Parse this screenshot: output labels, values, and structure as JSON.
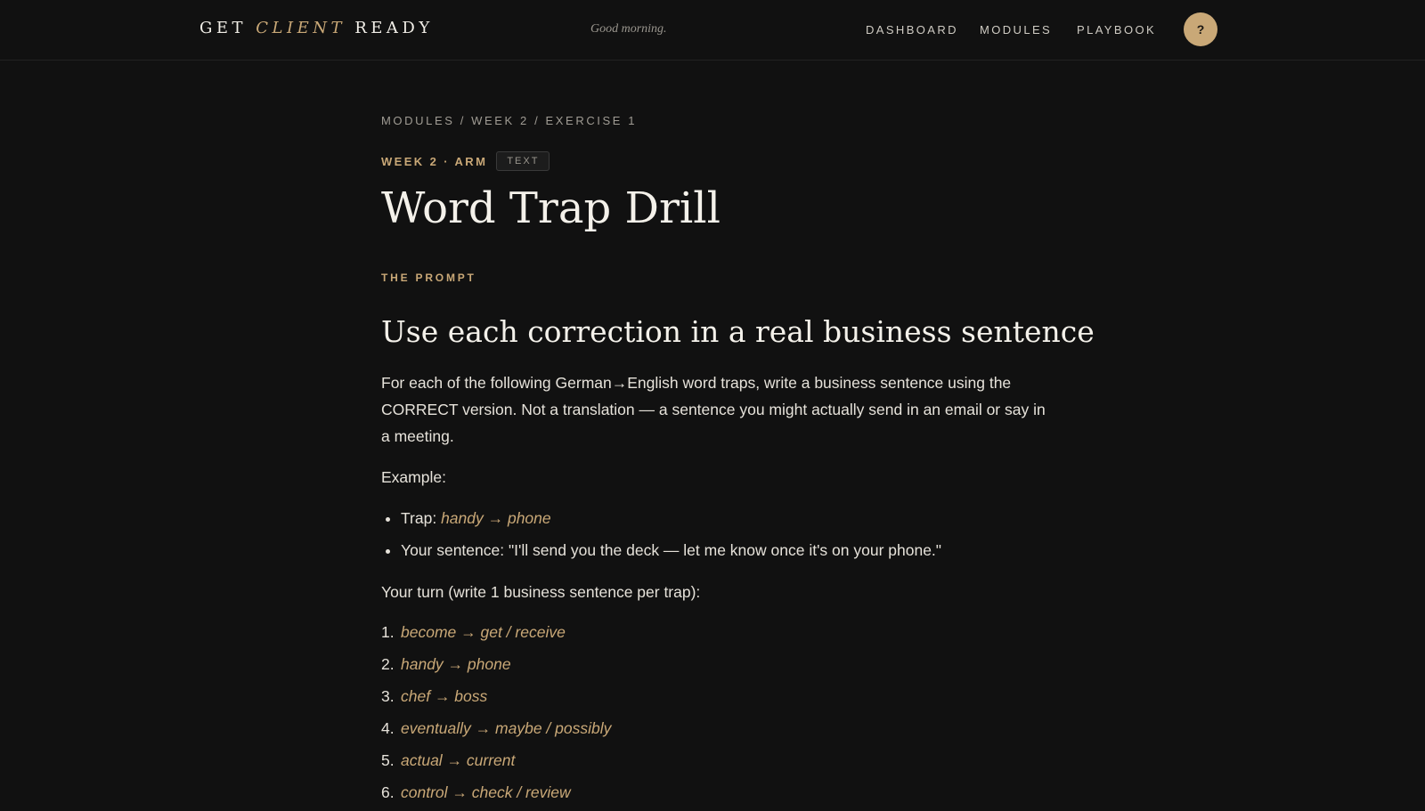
{
  "header": {
    "logo": {
      "part1": "GET ",
      "accent": "CLIENT",
      "part2": " READY"
    },
    "greeting": "Good morning.",
    "nav": {
      "dashboard": "DASHBOARD",
      "modules": "MODULES",
      "playbook": "PLAYBOOK"
    },
    "help_label": "?"
  },
  "breadcrumb": {
    "item1": "MODULES",
    "sep": " / ",
    "item2": "WEEK 2",
    "item3": "EXERCISE 1"
  },
  "meta": {
    "week_tag": "WEEK 2 · ARM",
    "type_badge": "TEXT"
  },
  "page_title": "Word Trap Drill",
  "section_label": "THE PROMPT",
  "prompt": {
    "heading": "Use each correction in a real business sentence",
    "intro": "For each of the following German→English word traps, write a business sentence using the CORRECT version. Not a translation — a sentence you might actually send in an email or say in a meeting.",
    "example_label": "Example:",
    "example": {
      "trap_label": "Trap: ",
      "trap_value": "handy → phone",
      "sentence": "Your sentence: \"I'll send you the deck — let me know once it's on your phone.\""
    },
    "turn_label": "Your turn (write 1 business sentence per trap):",
    "traps": [
      {
        "num": "1.",
        "text": "become → get / receive"
      },
      {
        "num": "2.",
        "text": "handy → phone"
      },
      {
        "num": "3.",
        "text": "chef → boss"
      },
      {
        "num": "4.",
        "text": "eventually → maybe / possibly"
      },
      {
        "num": "5.",
        "text": "actual → current"
      },
      {
        "num": "6.",
        "text": "control → check / review"
      }
    ]
  },
  "colors": {
    "background": "#111111",
    "accent": "#c9a877",
    "text": "#e6e2da"
  }
}
